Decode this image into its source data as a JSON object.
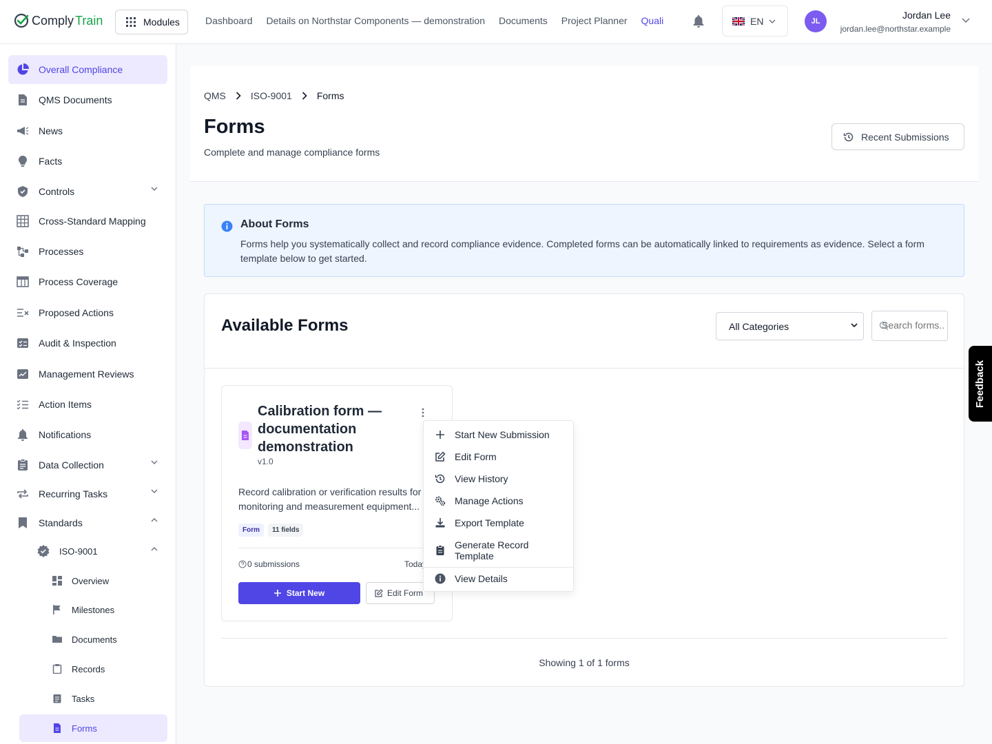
{
  "header": {
    "logo_part1": "Comply",
    "logo_part2": "Train",
    "modules_label": "Modules",
    "nav": [
      "Dashboard",
      "Details on Northstar Components — demonstration",
      "Documents",
      "Project Planner",
      "Quali"
    ],
    "language": "EN",
    "user": {
      "initials": "JL",
      "name": "Jordan Lee",
      "email": "jordan.lee@northstar.example"
    }
  },
  "sidebar": {
    "items": [
      {
        "label": "Overall Compliance",
        "icon": "pie-chart-icon"
      },
      {
        "label": "QMS Documents",
        "icon": "document-icon"
      },
      {
        "label": "News",
        "icon": "megaphone-icon"
      },
      {
        "label": "Facts",
        "icon": "lightbulb-icon"
      },
      {
        "label": "Controls",
        "icon": "shield-check-icon"
      },
      {
        "label": "Cross-Standard Mapping",
        "icon": "grid-icon"
      },
      {
        "label": "Processes",
        "icon": "flow-icon"
      },
      {
        "label": "Process Coverage",
        "icon": "table-icon"
      },
      {
        "label": "Proposed Actions",
        "icon": "list-x-icon"
      },
      {
        "label": "Audit & Inspection",
        "icon": "checklist-icon"
      },
      {
        "label": "Management Reviews",
        "icon": "chart-edit-icon"
      },
      {
        "label": "Action Items",
        "icon": "list-check-icon"
      },
      {
        "label": "Notifications",
        "icon": "bell-icon"
      },
      {
        "label": "Data Collection",
        "icon": "clipboard-icon"
      },
      {
        "label": "Recurring Tasks",
        "icon": "repeat-icon"
      },
      {
        "label": "Standards",
        "icon": "bookmark-icon"
      }
    ],
    "standard": "ISO-9001",
    "sub_items": [
      {
        "label": "Overview",
        "icon": "dashboard-icon"
      },
      {
        "label": "Milestones",
        "icon": "flag-icon"
      },
      {
        "label": "Documents",
        "icon": "folder-icon"
      },
      {
        "label": "Records",
        "icon": "clipboard-icon"
      },
      {
        "label": "Tasks",
        "icon": "task-icon"
      },
      {
        "label": "Forms",
        "icon": "form-icon"
      }
    ]
  },
  "page": {
    "breadcrumb": [
      "QMS",
      "ISO-9001",
      "Forms"
    ],
    "title": "Forms",
    "subtitle": "Complete and manage compliance forms",
    "recent_submissions": "Recent Submissions"
  },
  "info": {
    "title": "About Forms",
    "text": "Forms help you systematically collect and record compliance evidence. Completed forms can be automatically linked to requirements as evidence. Select a form template below to get started."
  },
  "forms_panel": {
    "title": "Available Forms",
    "category_value": "All Categories",
    "search_placeholder": "Search forms...",
    "showing": "Showing 1 of 1 forms"
  },
  "form_card": {
    "title": "Calibration form — documentation demonstration",
    "version": "v1.0",
    "description": "Record calibration or verification results for monitoring and measurement equipment...",
    "tag_type": "Form",
    "tag_fields": "11 fields",
    "submissions": "0 submissions",
    "date": "Today",
    "start_label": "Start New",
    "edit_label": "Edit Form"
  },
  "menu": {
    "items": [
      {
        "label": "Start New Submission",
        "icon": "plus-icon"
      },
      {
        "label": "Edit Form",
        "icon": "edit-icon"
      },
      {
        "label": "View History",
        "icon": "history-icon"
      },
      {
        "label": "Manage Actions",
        "icon": "gears-icon"
      },
      {
        "label": "Export Template",
        "icon": "download-icon"
      },
      {
        "label": "Generate Record Template",
        "icon": "clipboard-icon"
      },
      {
        "label": "View Details",
        "icon": "info-icon"
      }
    ]
  },
  "feedback_label": "Feedback",
  "colors": {
    "primary": "#4f46e5",
    "brand_green": "#16a34a",
    "active_bg": "#ede9fe",
    "info_bg": "#eef5ff"
  }
}
